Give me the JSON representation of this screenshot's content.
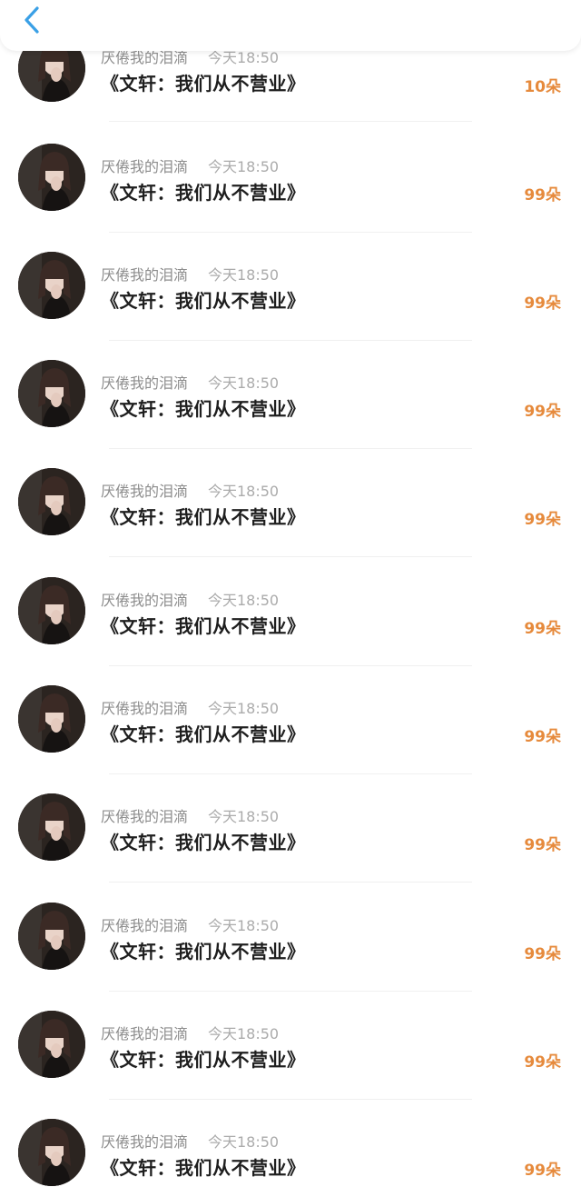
{
  "colors": {
    "accent_back": "#3aa0e6",
    "count": "#e68a3c",
    "name": "#8d8d8d",
    "time": "#ababab",
    "title": "#1e1e1e"
  },
  "header": {
    "back_icon": "chevron-left-icon"
  },
  "items": [
    {
      "name": "厌倦我的泪滴",
      "time": "今天18:50",
      "title": "《文轩：我们从不营业》",
      "count": "10朵"
    },
    {
      "name": "厌倦我的泪滴",
      "time": "今天18:50",
      "title": "《文轩：我们从不营业》",
      "count": "99朵"
    },
    {
      "name": "厌倦我的泪滴",
      "time": "今天18:50",
      "title": "《文轩：我们从不营业》",
      "count": "99朵"
    },
    {
      "name": "厌倦我的泪滴",
      "time": "今天18:50",
      "title": "《文轩：我们从不营业》",
      "count": "99朵"
    },
    {
      "name": "厌倦我的泪滴",
      "time": "今天18:50",
      "title": "《文轩：我们从不营业》",
      "count": "99朵"
    },
    {
      "name": "厌倦我的泪滴",
      "time": "今天18:50",
      "title": "《文轩：我们从不营业》",
      "count": "99朵"
    },
    {
      "name": "厌倦我的泪滴",
      "time": "今天18:50",
      "title": "《文轩：我们从不营业》",
      "count": "99朵"
    },
    {
      "name": "厌倦我的泪滴",
      "time": "今天18:50",
      "title": "《文轩：我们从不营业》",
      "count": "99朵"
    },
    {
      "name": "厌倦我的泪滴",
      "time": "今天18:50",
      "title": "《文轩：我们从不营业》",
      "count": "99朵"
    },
    {
      "name": "厌倦我的泪滴",
      "time": "今天18:50",
      "title": "《文轩：我们从不营业》",
      "count": "99朵"
    },
    {
      "name": "厌倦我的泪滴",
      "time": "今天18:50",
      "title": "《文轩：我们从不营业》",
      "count": "99朵"
    }
  ]
}
